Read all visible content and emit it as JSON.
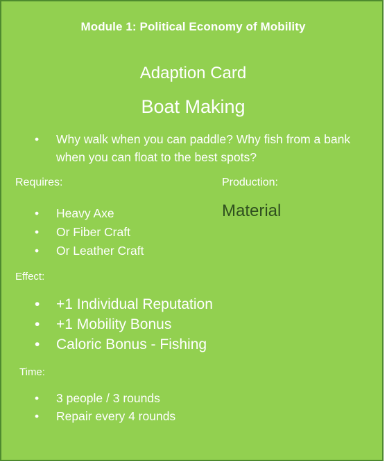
{
  "card": {
    "module_title": "Module 1: Political Economy of Mobility",
    "card_type": "Adaption Card",
    "card_name": "Boat Making",
    "description_bullet": "•",
    "description": "Why walk when you can paddle?  Why fish from a bank when you can float to the best spots?",
    "colors": {
      "background": "#92d050",
      "border": "#4e8a2e",
      "text": "#ffffff",
      "production_value": "#2f4f1f"
    }
  },
  "requires": {
    "label": "Requires:",
    "items": [
      "Heavy Axe",
      "Or Fiber Craft",
      "Or Leather Craft"
    ]
  },
  "production": {
    "label": "Production:",
    "value": "Material"
  },
  "effect": {
    "label": "Effect:",
    "items": [
      "+1 Individual Reputation",
      "+1 Mobility Bonus",
      "Caloric Bonus - Fishing"
    ]
  },
  "time": {
    "label": "Time:",
    "items": [
      "3 people / 3 rounds",
      "Repair every 4 rounds"
    ]
  },
  "bullet_char": "•"
}
